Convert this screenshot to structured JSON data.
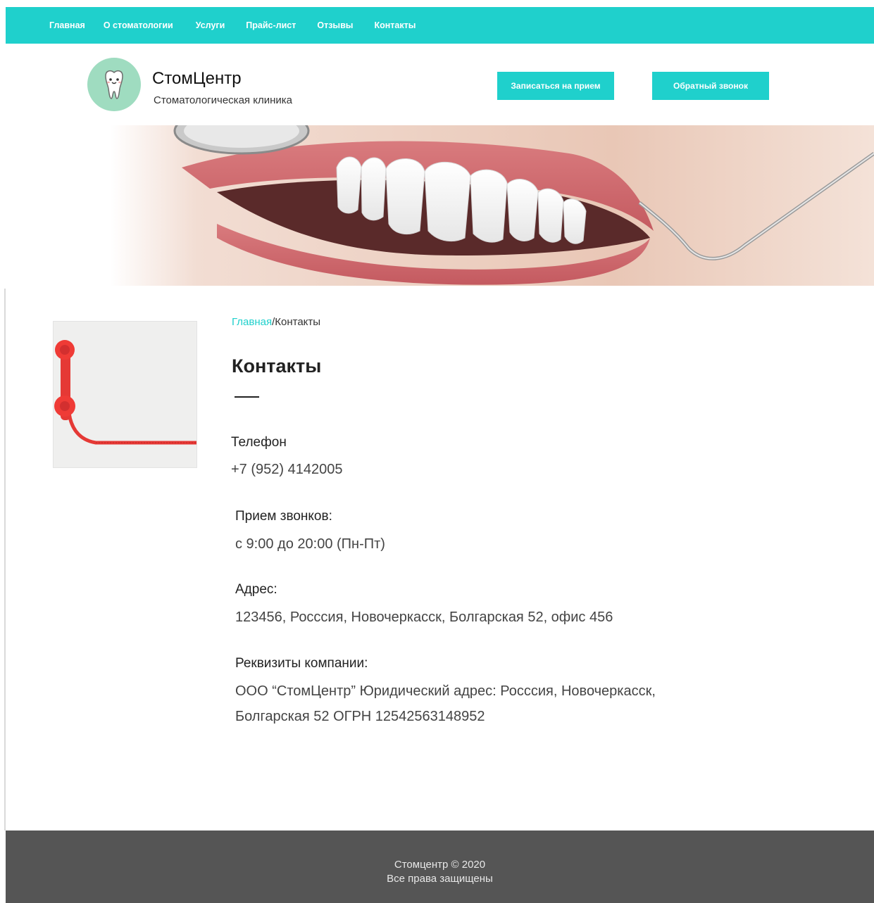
{
  "nav": {
    "items": [
      {
        "label": "Главная"
      },
      {
        "label": "О стоматологии"
      },
      {
        "label": "Услуги"
      },
      {
        "label": "Прайс-лист"
      },
      {
        "label": "Отзывы"
      },
      {
        "label": "Контакты"
      }
    ]
  },
  "header": {
    "brand_name": "СтомЦентр",
    "brand_subtitle": "Стоматологическая клиника",
    "book_button": "Записаться на прием",
    "callback_button": "Обратный звонок"
  },
  "breadcrumb": {
    "home": "Главная",
    "separator": "/",
    "current": "Контакты"
  },
  "page": {
    "title": "Контакты"
  },
  "contacts": {
    "phone_label": "Телефон",
    "phone_value": "+7 (952) 4142005",
    "hours_label": "Прием звонков:",
    "hours_value": "с 9:00 до 20:00 (Пн-Пт)",
    "address_label": "Адрес:",
    "address_value": "123456, Росссия, Новочеркасск, Болгарская 52, офис 456",
    "requisites_label": "Реквизиты компании:",
    "requisites_line1": "ООО “СтомЦентр” Юридический адрес: Росссия, Новочеркасск,",
    "requisites_line2": "Болгарская 52 ОГРН 12542563148952"
  },
  "footer": {
    "copyright": "Стомцентр © 2020",
    "rights": "Все права защищены"
  },
  "colors": {
    "accent": "#1fd0cc",
    "footer_bg": "#555555",
    "logo_bg": "#9fdcc0"
  },
  "icons": {
    "logo": "tooth-icon",
    "side_image": "red-telephone-handset"
  }
}
